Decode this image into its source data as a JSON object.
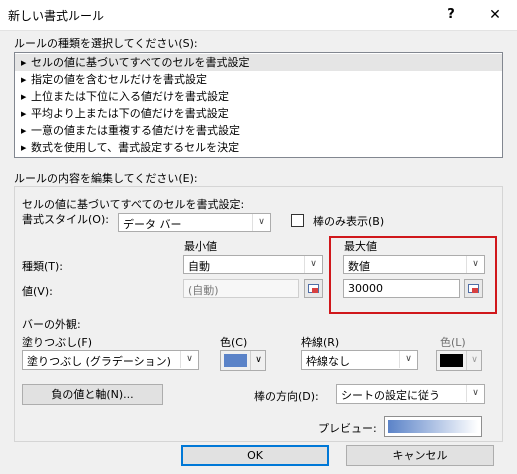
{
  "window": {
    "title": "新しい書式ルール",
    "help_glyph": "?",
    "close_glyph": "✕"
  },
  "rule_type": {
    "label": "ルールの種類を選択してください(S):",
    "items": [
      "セルの値に基づいてすべてのセルを書式設定",
      "指定の値を含むセルだけを書式設定",
      "上位または下位に入る値だけを書式設定",
      "平均より上または下の値だけを書式設定",
      "一意の値または重複する値だけを書式設定",
      "数式を使用して、書式設定するセルを決定"
    ],
    "selected_index": 0
  },
  "edit": {
    "label": "ルールの内容を編集してください(E):",
    "sub_label": "セルの値に基づいてすべてのセルを書式設定:",
    "format_style_label": "書式スタイル(O):",
    "format_style_value": "データ バー",
    "bar_only_label": "棒のみ表示(B)",
    "bar_only_checked": false,
    "min_header": "最小値",
    "max_header": "最大値",
    "type_label": "種類(T):",
    "value_label": "値(V):",
    "min_type": "自動",
    "min_value": "(自動)",
    "max_type": "数値",
    "max_value": "30000"
  },
  "bar_appearance": {
    "label": "バーの外観:",
    "fill_label": "塗りつぶし(F)",
    "fill_value": "塗りつぶし (グラデーション)",
    "fill_color_label": "色(C)",
    "fill_color": "#5b83c8",
    "border_label": "枠線(R)",
    "border_value": "枠線なし",
    "border_color_label": "色(L)",
    "border_color": "#000000",
    "negative_button": "負の値と軸(N)...",
    "direction_label": "棒の方向(D):",
    "direction_value": "シートの設定に従う",
    "preview_label": "プレビュー:"
  },
  "footer": {
    "ok": "OK",
    "cancel": "キャンセル"
  }
}
